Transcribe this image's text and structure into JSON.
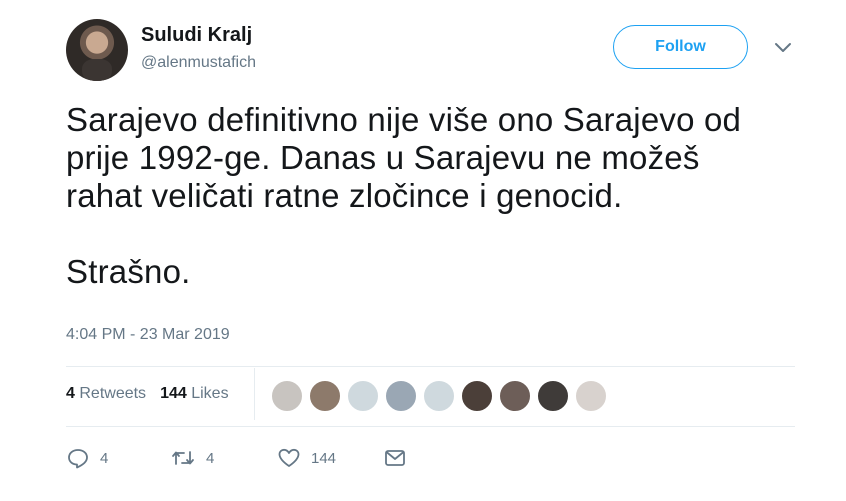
{
  "user": {
    "name": "Suludi Kralj",
    "handle": "@alenmustafich"
  },
  "follow_label": "Follow",
  "tweet": {
    "text": "Sarajevo definitivno nije više ono Sarajevo od\nprije 1992-ge. Danas u Sarajevu ne možeš\nrahat veličati ratne zločince i genocid.\n\nStrašno.",
    "timestamp": "4:04 PM - 23 Mar 2019"
  },
  "stats": {
    "retweets_count": "4",
    "retweets_label": "Retweets",
    "likes_count": "144",
    "likes_label": "Likes"
  },
  "liker_avatars": [
    "#c8c4c0",
    "#8d7a6b",
    "#cfd9de",
    "#9aa7b4",
    "#cfd9de",
    "#4b3f39",
    "#6d5e58",
    "#3f3b39",
    "#d8d2ce"
  ],
  "actions": {
    "reply_count": "4",
    "retweet_count": "4",
    "like_count": "144"
  },
  "colors": {
    "accent": "#1da1f2",
    "secondary_text": "#657786",
    "divider": "#e6ecf0"
  },
  "icons": [
    "chevron-down-icon",
    "reply-icon",
    "retweet-icon",
    "heart-icon",
    "message-icon"
  ]
}
